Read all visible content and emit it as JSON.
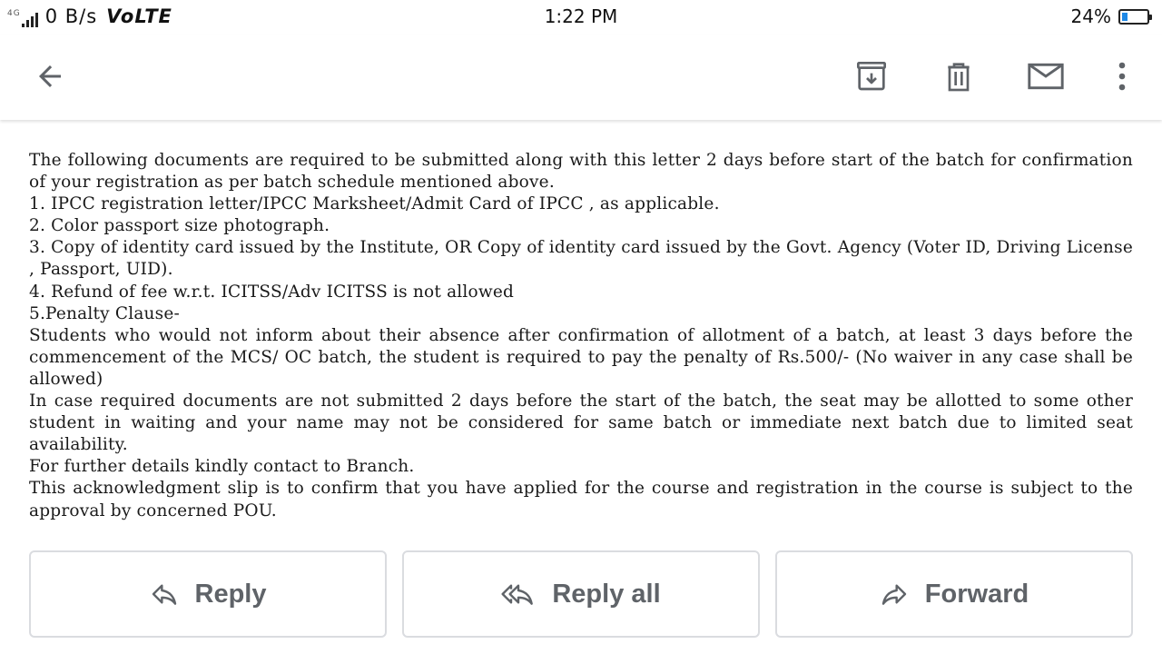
{
  "status_bar": {
    "network_type": "4G",
    "speed": "0 B/s",
    "volte": "VoLTE",
    "time": "1:22 PM",
    "battery_percent": "24%",
    "battery_level": 0.24
  },
  "toolbar": {
    "back_icon": "arrow-back-icon",
    "archive_icon": "archive-icon",
    "delete_icon": "trash-icon",
    "mark_unread_icon": "mail-icon",
    "more_icon": "more-vertical-icon"
  },
  "email_body": {
    "paragraphs": [
      "The following documents are required to be submitted along with this letter 2 days before start of the batch for confirmation of your registration as per batch schedule mentioned above.",
      "1. IPCC registration letter/IPCC Marksheet/Admit Card of IPCC , as applicable.",
      "2. Color passport size photograph.",
      "3. Copy of identity card issued by the Institute, OR Copy of identity card issued by the Govt. Agency (Voter ID, Driving License , Passport, UID).",
      "4. Refund of fee w.r.t. ICITSS/Adv ICITSS is not allowed",
      "5.Penalty Clause-",
      "Students who would not inform about their absence after confirmation of allotment of a batch, at least 3 days before the commencement of the MCS/ OC batch, the student is required to pay the penalty of Rs.500/- (No waiver in any case shall be allowed)",
      "In case required documents are not submitted 2 days before the start of the batch, the seat may be allotted to some other student in waiting and your name may not be considered for same batch or immediate next batch due to limited seat availability.",
      "For further details kindly contact to Branch.",
      "This acknowledgment slip is to confirm that you have applied for the course and registration in the course is subject to the approval by concerned POU."
    ]
  },
  "actions": {
    "reply_label": "Reply",
    "reply_all_label": "Reply all",
    "forward_label": "Forward"
  }
}
